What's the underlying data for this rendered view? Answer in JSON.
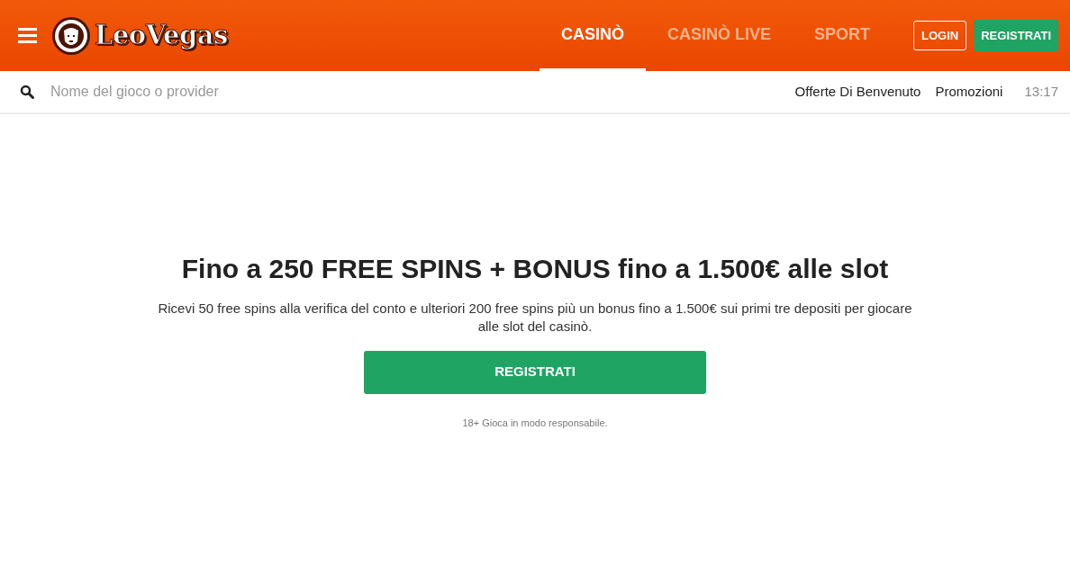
{
  "header": {
    "logo": "LeoVegas",
    "tabs": [
      {
        "label": "CASINÒ",
        "selected": true
      },
      {
        "label": "CASINÒ LIVE",
        "selected": false
      },
      {
        "label": "SPORT",
        "selected": false
      }
    ],
    "login": "LOGIN",
    "register": "REGISTRATI"
  },
  "subbar": {
    "search": {
      "placeholder": "Nome del gioco o provider"
    },
    "links": [
      "Offerte Di Benvenuto",
      "Promozioni"
    ],
    "time": "13:17"
  },
  "hero": {
    "title": "Fino a 250 FREE SPINS + BONUS fino a 1.500€ alle slot",
    "text": "Ricevi 50 free spins alla verifica del conto e ulteriori 200 free spins più un bonus fino a 1.500€ sui primi tre depositi per giocare alle slot del casinò.",
    "button": "REGISTRATI",
    "note": "18+ Gioca in modo responsabile."
  }
}
